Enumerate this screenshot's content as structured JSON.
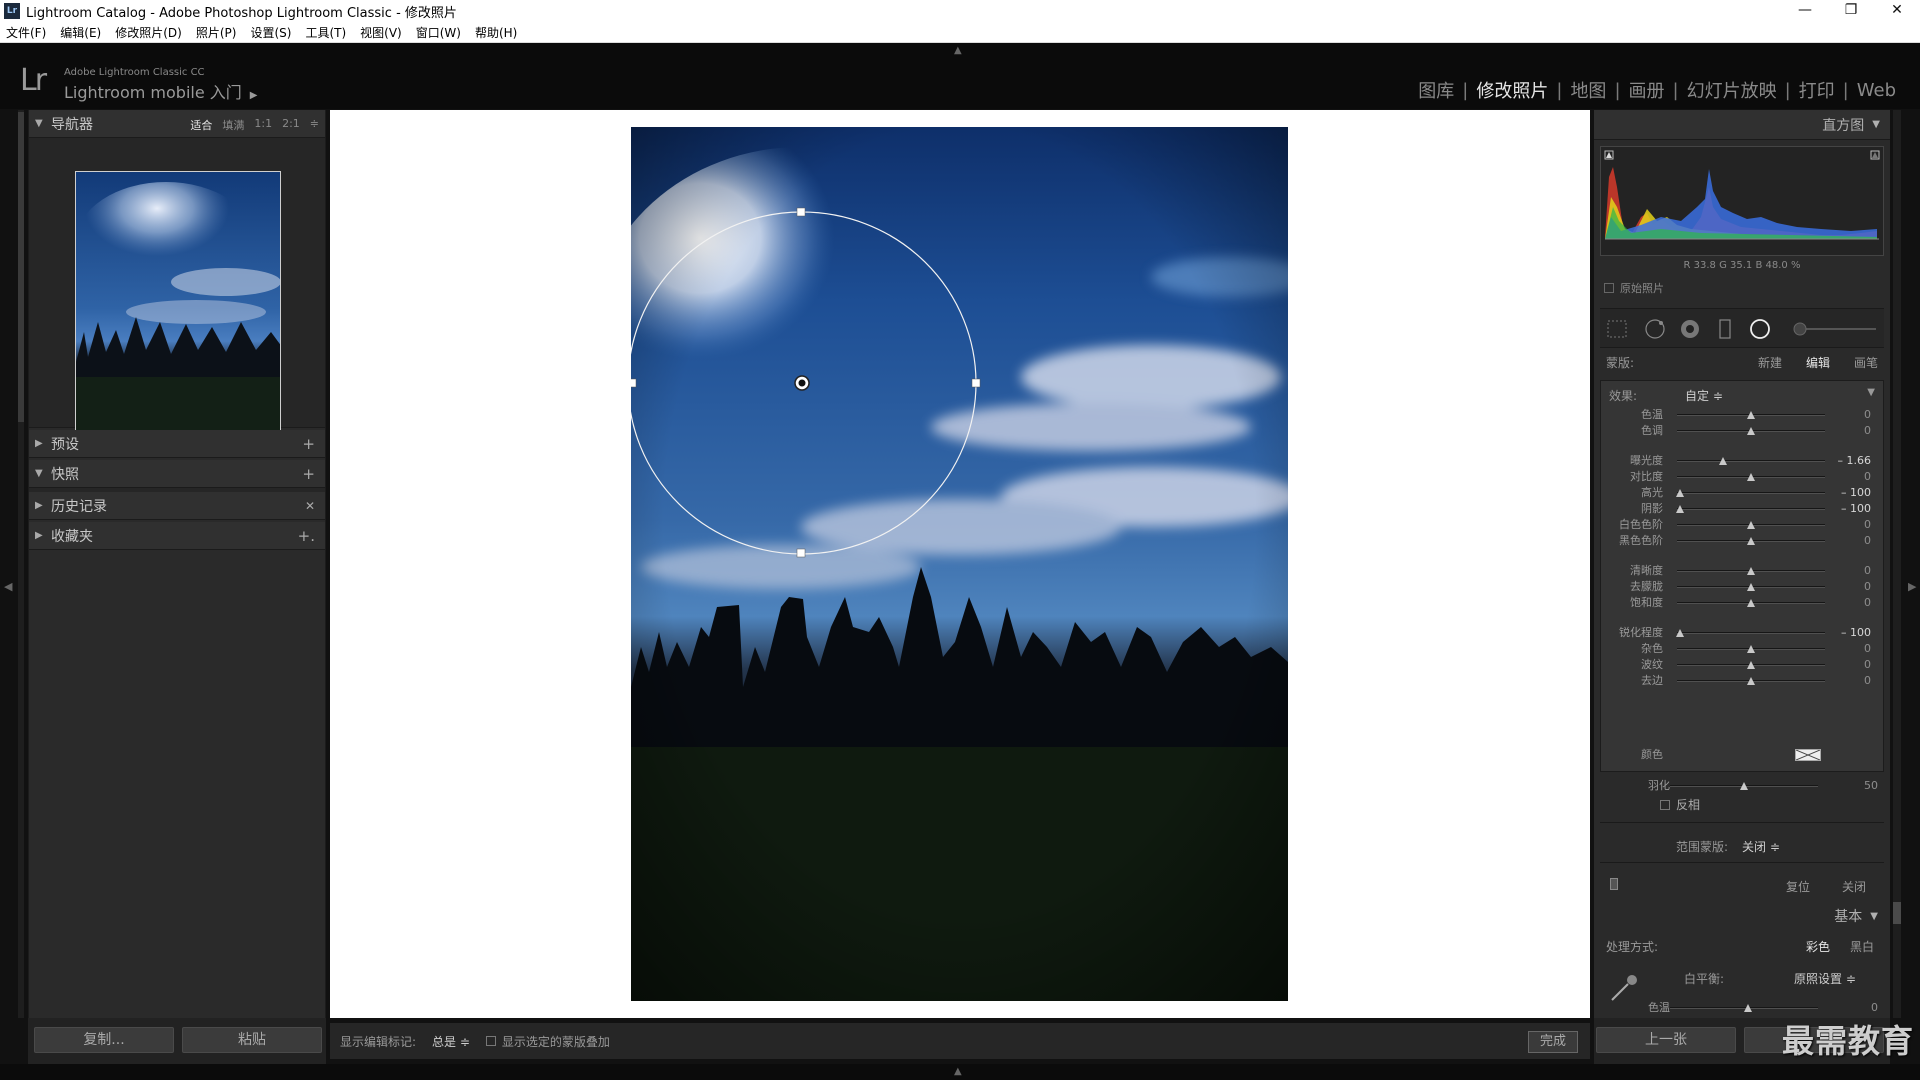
{
  "window": {
    "title": "Lightroom Catalog - Adobe Photoshop Lightroom Classic - 修改照片",
    "badge": "Lr",
    "minimize": "—",
    "maximize": "❐",
    "close": "✕"
  },
  "menu": [
    "文件(F)",
    "编辑(E)",
    "修改照片(D)",
    "照片(P)",
    "设置(S)",
    "工具(T)",
    "视图(V)",
    "窗口(W)",
    "帮助(H)"
  ],
  "identity": {
    "logo": "Lr",
    "product": "Adobe Lightroom Classic CC",
    "mobile": "Lightroom mobile 入门",
    "arrow": "▶"
  },
  "modules": [
    "图库",
    "修改照片",
    "地图",
    "画册",
    "幻灯片放映",
    "打印",
    "Web"
  ],
  "active_module": 1,
  "left": {
    "navigator": {
      "title": "导航器",
      "options": [
        "适合",
        "填满",
        "1:1",
        "2:1"
      ],
      "more": "≑"
    },
    "panels": [
      {
        "title": "预设",
        "action": "+"
      },
      {
        "title": "快照",
        "action": "+"
      },
      {
        "title": "历史记录",
        "action": "✕"
      },
      {
        "title": "收藏夹",
        "action": "+."
      }
    ],
    "copy_button": "复制...",
    "paste_button": "粘贴"
  },
  "toolbar": {
    "show_edit_pins_label": "显示编辑标记:",
    "show_edit_pins_value": "总是 ≑",
    "show_mask_overlay": "显示选定的蒙版叠加",
    "done": "完成"
  },
  "right": {
    "histogram": {
      "title": "直方图",
      "readout": "R  33.8  G  35.1  B  48.0 %"
    },
    "original_photo": "原始照片",
    "mask": {
      "label": "蒙版:",
      "new": "新建",
      "edit": "编辑",
      "brush": "画笔"
    },
    "effect": {
      "label": "效果:",
      "value": "自定 ≑"
    },
    "sliders": [
      {
        "label": "色温",
        "value": "0",
        "pos": 0.5,
        "hi": false
      },
      {
        "label": "色调",
        "value": "0",
        "pos": 0.5,
        "hi": false
      },
      {
        "label": "曝光度",
        "value": "– 1.66",
        "pos": 0.31,
        "hi": true
      },
      {
        "label": "对比度",
        "value": "0",
        "pos": 0.5,
        "hi": false
      },
      {
        "label": "高光",
        "value": "– 100",
        "pos": 0.02,
        "hi": true
      },
      {
        "label": "阴影",
        "value": "– 100",
        "pos": 0.02,
        "hi": true
      },
      {
        "label": "白色色阶",
        "value": "0",
        "pos": 0.5,
        "hi": false
      },
      {
        "label": "黑色色阶",
        "value": "0",
        "pos": 0.5,
        "hi": false
      },
      {
        "label": "清晰度",
        "value": "0",
        "pos": 0.5,
        "hi": false
      },
      {
        "label": "去朦胧",
        "value": "0",
        "pos": 0.5,
        "hi": false
      },
      {
        "label": "饱和度",
        "value": "0",
        "pos": 0.5,
        "hi": false
      },
      {
        "label": "锐化程度",
        "value": "– 100",
        "pos": 0.02,
        "hi": true
      },
      {
        "label": "杂色",
        "value": "0",
        "pos": 0.5,
        "hi": false
      },
      {
        "label": "波纹",
        "value": "0",
        "pos": 0.5,
        "hi": false
      },
      {
        "label": "去边",
        "value": "0",
        "pos": 0.5,
        "hi": false
      }
    ],
    "color_label": "颜色",
    "feather": {
      "label": "羽化",
      "value": "50",
      "pos": 0.5
    },
    "invert": "反相",
    "range_mask": {
      "label": "范围蒙版:",
      "value": "关闭 ≑"
    },
    "reset": "复位",
    "close": "关闭",
    "basic": {
      "title": "基本",
      "treatment_label": "处理方式:",
      "color": "彩色",
      "bw": "黑白",
      "wb_label": "白平衡:",
      "wb_value": "原照设置 ≑",
      "temp_label": "色温",
      "temp_value": "0"
    },
    "prev_button": "上一张"
  },
  "watermark": "最需教育"
}
